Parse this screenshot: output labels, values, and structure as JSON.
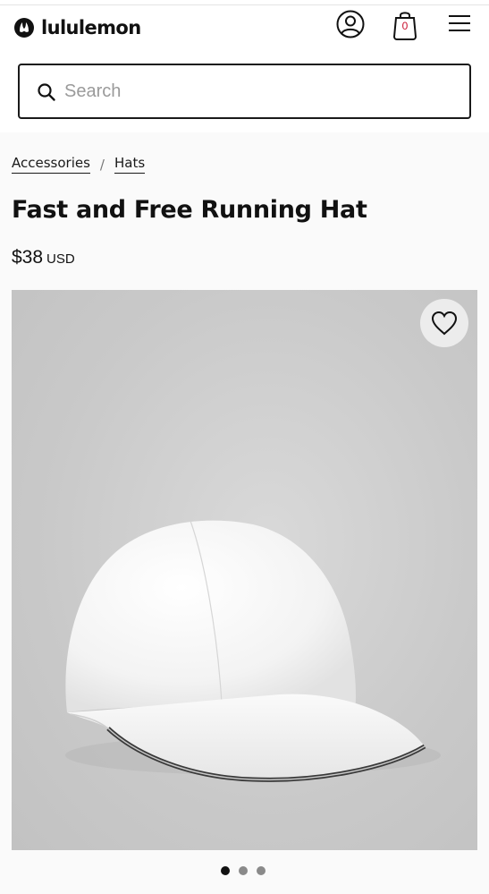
{
  "header": {
    "brand_name": "lululemon",
    "bag_count": "0"
  },
  "search": {
    "placeholder": "Search",
    "value": ""
  },
  "breadcrumb": {
    "items": [
      {
        "label": "Accessories"
      },
      {
        "label": "Hats"
      }
    ],
    "separator": "/"
  },
  "product": {
    "title": "Fast and Free Running Hat",
    "price": "$38",
    "currency": "USD"
  },
  "gallery": {
    "image_count": 3,
    "active_index": 0
  },
  "colors": {
    "accent": "#c8102e",
    "text": "#1a1a1a"
  }
}
